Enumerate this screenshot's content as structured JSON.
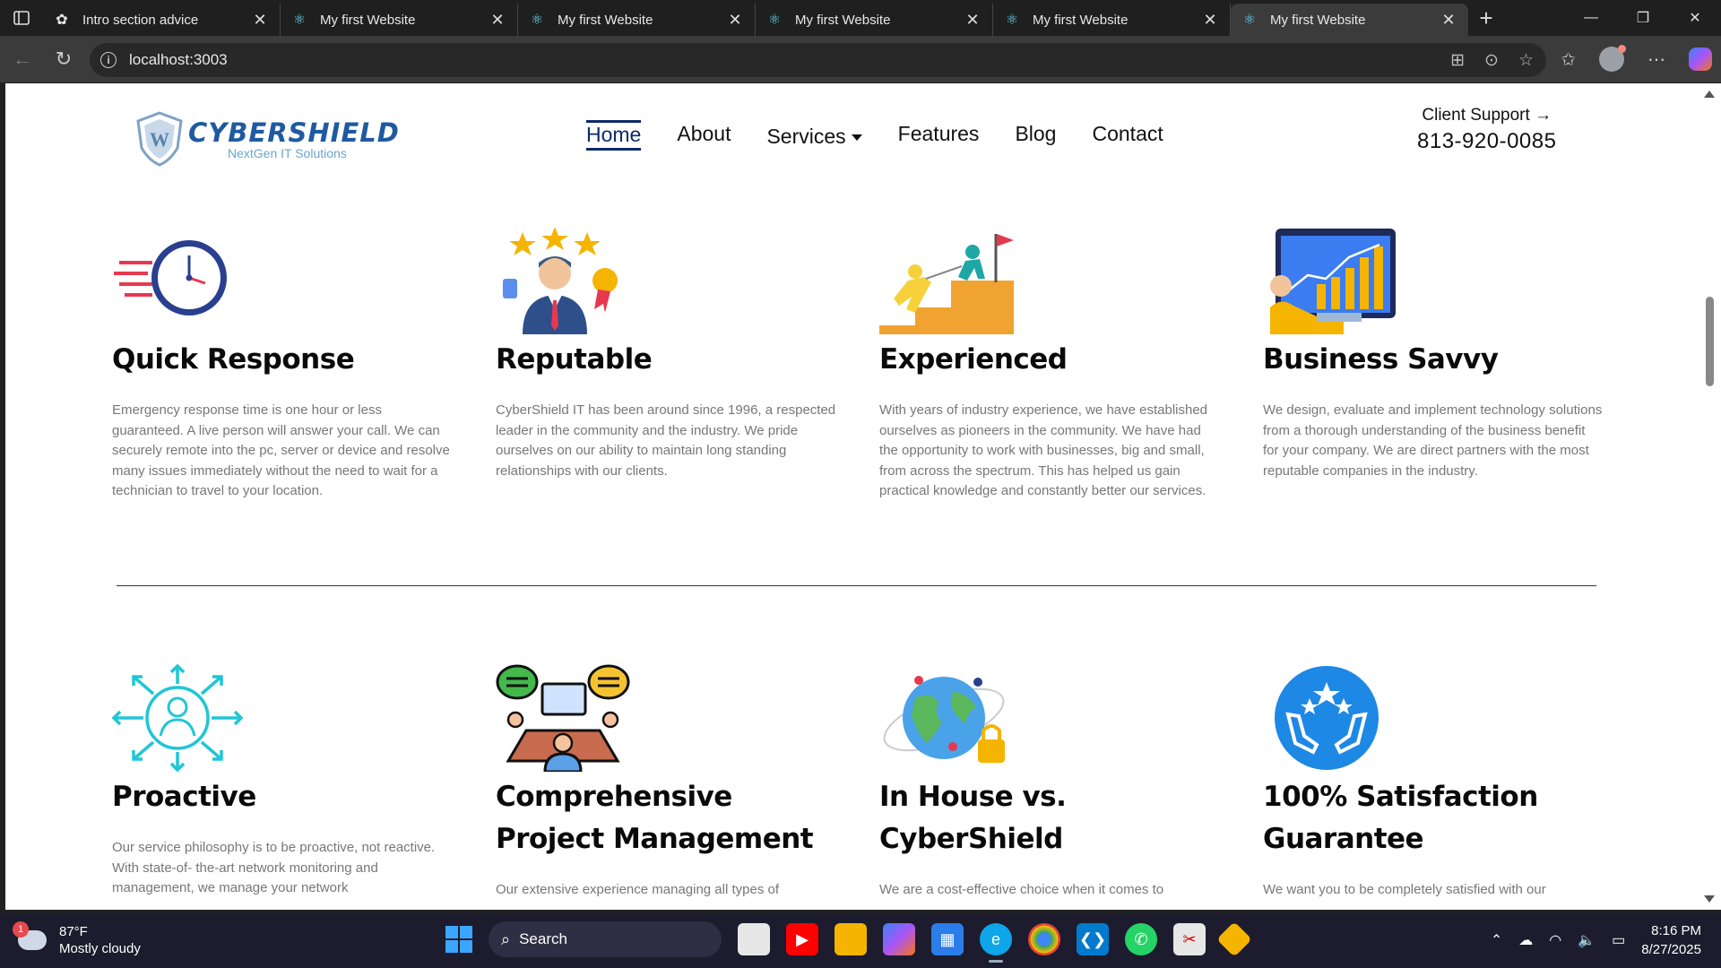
{
  "browser": {
    "tabs": [
      {
        "label": "Intro section advice",
        "icon": "chatgpt-icon",
        "active": false
      },
      {
        "label": "My first Website",
        "icon": "react-icon",
        "active": false
      },
      {
        "label": "My first Website",
        "icon": "react-icon",
        "active": false
      },
      {
        "label": "My first Website",
        "icon": "react-icon",
        "active": false
      },
      {
        "label": "My first Website",
        "icon": "react-icon",
        "active": false
      },
      {
        "label": "My first Website",
        "icon": "react-icon",
        "active": true
      }
    ],
    "url": "localhost:3003"
  },
  "site": {
    "logo": {
      "name": "CYBERSHIELD",
      "tagline": "NextGen IT Solutions"
    },
    "nav": [
      {
        "label": "Home",
        "active": true
      },
      {
        "label": "About"
      },
      {
        "label": "Services",
        "dropdown": true
      },
      {
        "label": "Features"
      },
      {
        "label": "Blog"
      },
      {
        "label": "Contact"
      }
    ],
    "support": {
      "label": "Client Support",
      "arrow": "→",
      "phone": "813-920-0085"
    },
    "features": [
      {
        "title": "Quick Response",
        "icon": "fast-clock-icon",
        "text": "Emergency response time is one hour or less guaranteed. A live person will answer your call. We can securely remote into the pc, server or device and resolve many issues immediately without the need to wait for a technician to travel to your location."
      },
      {
        "title": "Reputable",
        "icon": "businessman-stars-icon",
        "text": "CyberShield IT has been around since 1996, a respected leader in the community and the industry. We pride ourselves on our ability to maintain long standing relationships with our clients."
      },
      {
        "title": "Experienced",
        "icon": "climbing-flag-icon",
        "text": "With years of industry experience, we have established ourselves as pioneers in the community. We have had the opportunity to work with businesses, big and small, from across the spectrum. This has helped us gain practical knowledge and constantly better our services."
      },
      {
        "title": "Business Savvy",
        "icon": "growth-chart-icon",
        "text": "We design, evaluate and implement technology solutions from a thorough understanding of the business benefit for your company. We are direct partners with the most reputable companies in the industry."
      },
      {
        "title": "Proactive",
        "icon": "proactive-person-icon",
        "text": "Our service philosophy is to be proactive, not reactive. With state-of- the-art network monitoring and management, we manage your network"
      },
      {
        "title": "Comprehensive Project Management",
        "icon": "meeting-table-icon",
        "text": "Our extensive experience managing all types of"
      },
      {
        "title": "In House vs. CyberShield",
        "icon": "globe-lock-icon",
        "text": "We are a cost-effective choice when it comes to"
      },
      {
        "title": "100% Satisfaction Guarantee",
        "icon": "hands-stars-icon",
        "text": "We want you to be completely satisfied with our"
      }
    ]
  },
  "taskbar": {
    "weather": {
      "temp": "87°F",
      "condition": "Mostly cloudy",
      "badge": "1"
    },
    "search_label": "Search",
    "time": "8:16 PM",
    "date": "8/27/2025"
  }
}
